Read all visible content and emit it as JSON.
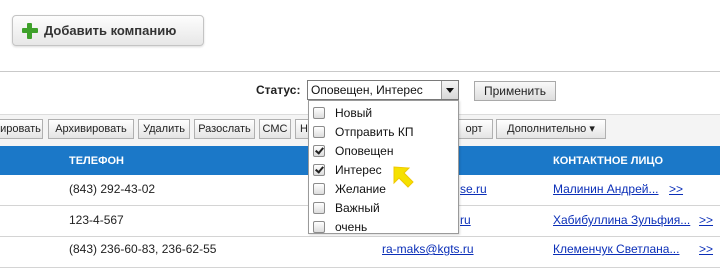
{
  "add_company_label": "Добавить компанию",
  "status_filter": {
    "label": "Статус:",
    "selected_value": "Оповещен, Интерес",
    "apply_label": "Применить",
    "options": [
      {
        "label": "Новый",
        "checked": false
      },
      {
        "label": "Отправить КП",
        "checked": false
      },
      {
        "label": "Оповещен",
        "checked": true
      },
      {
        "label": "Интерес",
        "checked": true
      },
      {
        "label": "Желание",
        "checked": false
      },
      {
        "label": "Важный",
        "checked": false
      },
      {
        "label": "очень",
        "checked": false
      }
    ]
  },
  "toolbar": {
    "buttons": [
      "ировать",
      "Архивировать",
      "Удалить",
      "Разослать",
      "СМС",
      "Нов",
      "орт",
      "Дополнительно ▾"
    ]
  },
  "table": {
    "headers": {
      "phone": "ТЕЛЕФОН",
      "contact": "КОНТАКТНОЕ ЛИЦО"
    },
    "rows": [
      {
        "phone": "(843) 292-43-02",
        "email": "se.ru",
        "contact": "Малинин Андрей...",
        "more": ">>"
      },
      {
        "phone": "123-4-567",
        "email": "ru",
        "contact": "Хабибуллина Зульфия...",
        "more": ">>"
      },
      {
        "phone": "(843) 236-60-83, 236-62-55",
        "email": "ra-maks@kgts.ru",
        "contact": "Клеменчук Светлана...",
        "more": ">>"
      }
    ]
  },
  "colors": {
    "header_blue": "#1b78c8",
    "accent_green": "#3fa12b",
    "cursor_yellow": "#f5e100"
  }
}
